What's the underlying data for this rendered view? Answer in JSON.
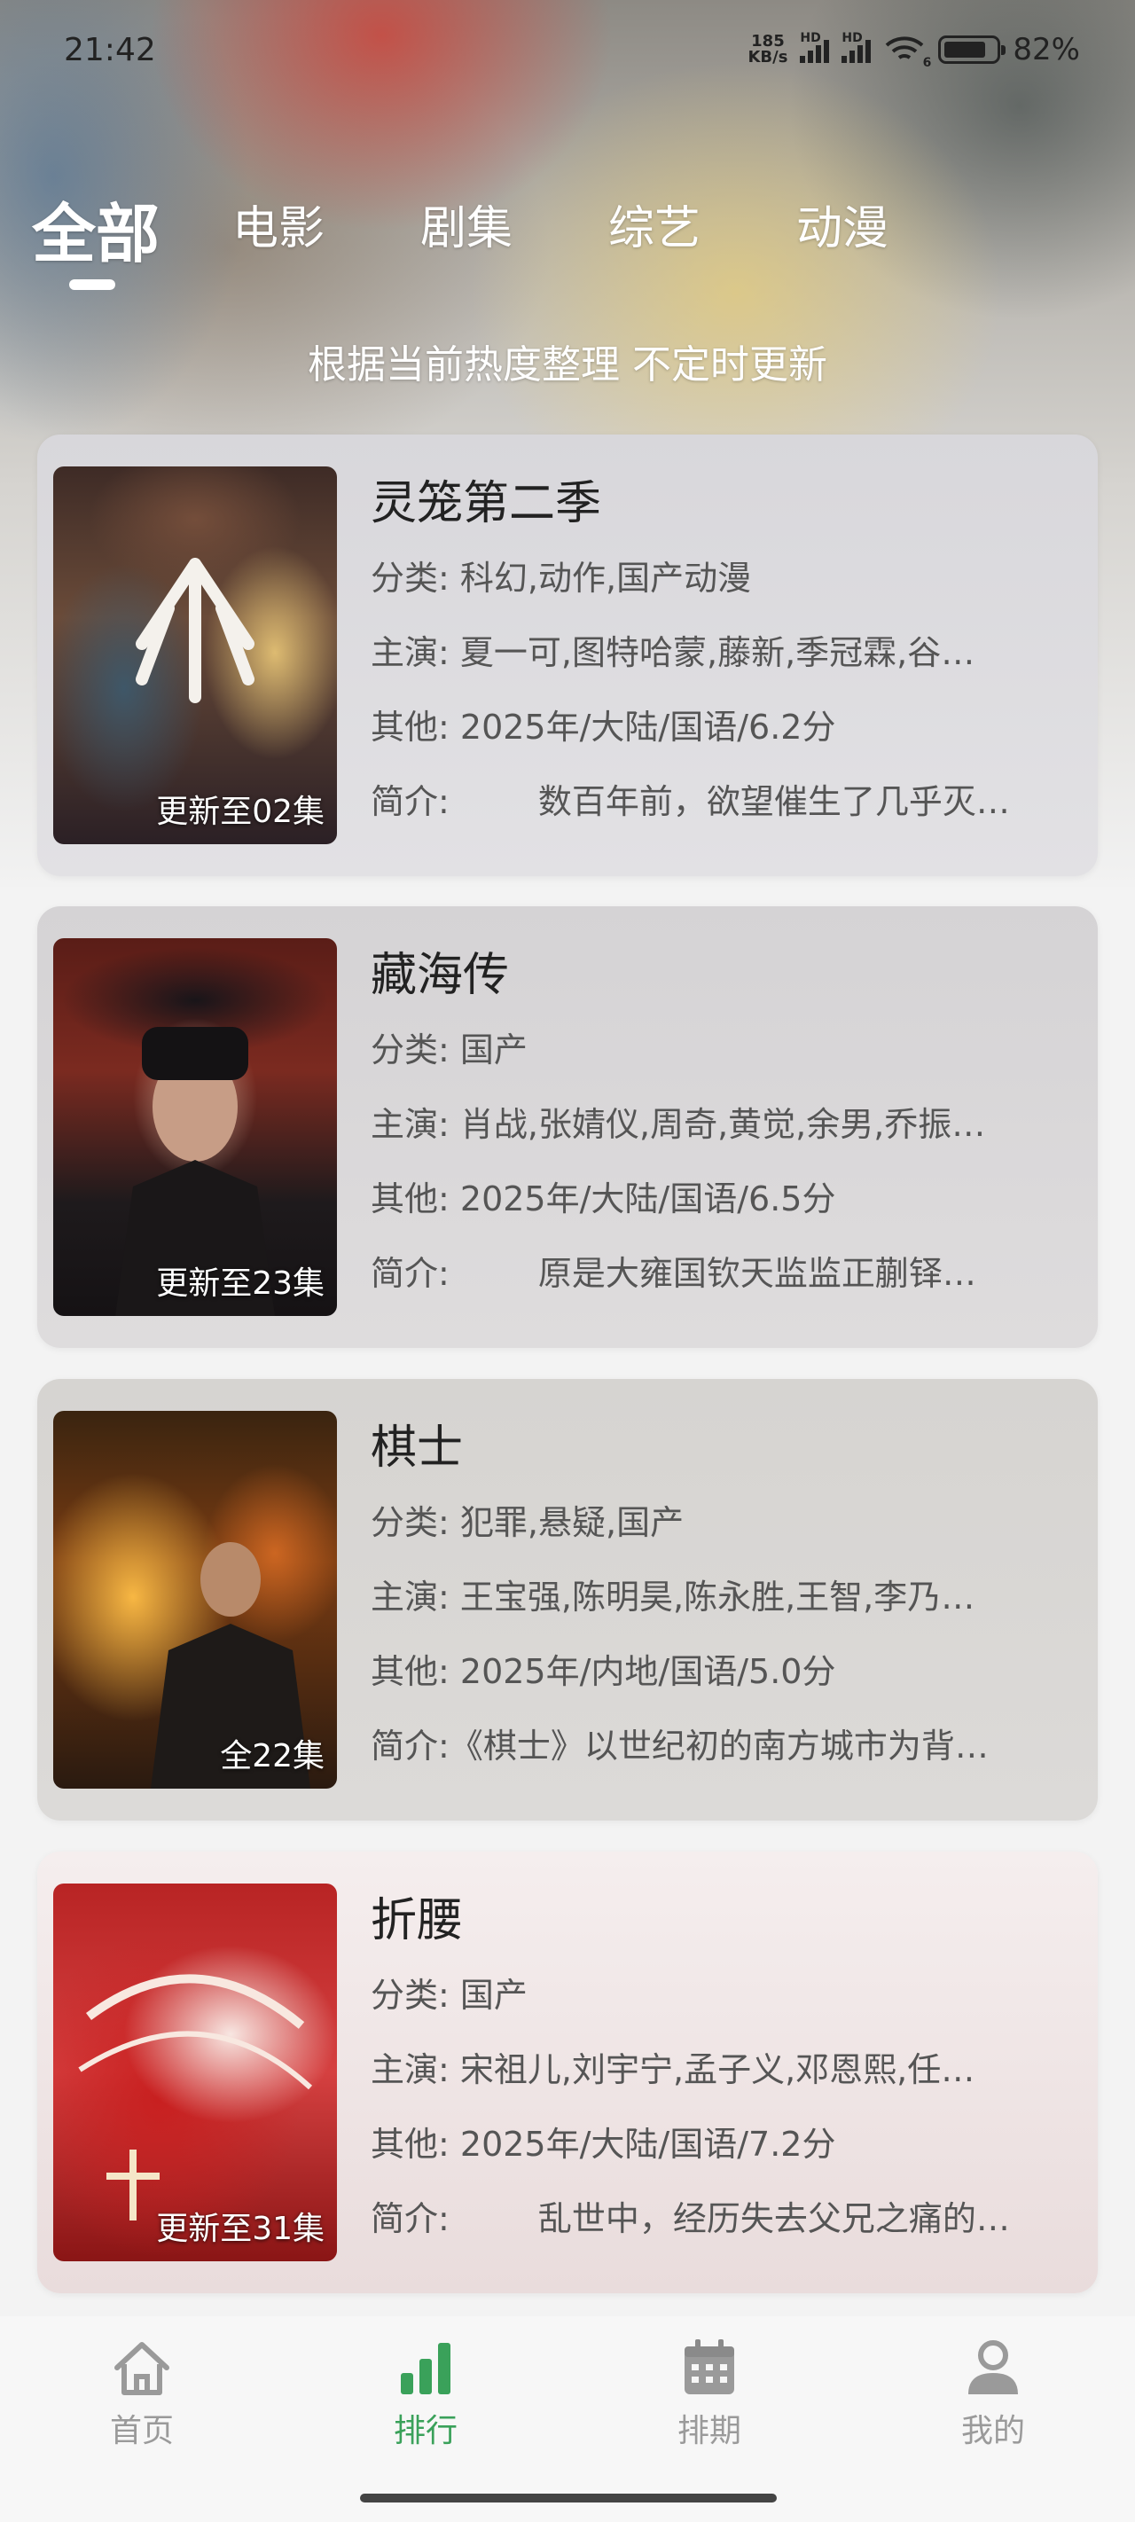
{
  "status_bar": {
    "time": "21:42",
    "net_speed_value": "185",
    "net_speed_unit": "KB/s",
    "sim1_tag": "HD",
    "sim2_tag": "HD",
    "wifi_tag": "6",
    "battery_percent": "82%",
    "battery_level": 0.82
  },
  "tabs": [
    {
      "label": "全部",
      "active": true
    },
    {
      "label": "电影",
      "active": false
    },
    {
      "label": "剧集",
      "active": false
    },
    {
      "label": "综艺",
      "active": false
    },
    {
      "label": "动漫",
      "active": false
    }
  ],
  "subtitle": "根据当前热度整理 不定时更新",
  "labels": {
    "category": "分类:",
    "cast": "主演:",
    "other": "其他:",
    "intro": "简介:"
  },
  "items": [
    {
      "title": "灵笼第二季",
      "episode": "更新至02集",
      "category": "科幻,动作,国产动漫",
      "cast": "夏一可,图特哈蒙,藤新,季冠霖,谷…",
      "other": "2025年/大陆/国语/6.2分",
      "intro": "数百年前，欲望催生了几乎灭…",
      "intro_indented": true
    },
    {
      "title": "藏海传",
      "episode": "更新至23集",
      "category": "国产",
      "cast": "肖战,张婧仪,周奇,黄觉,余男,乔振…",
      "other": "2025年/大陆/国语/6.5分",
      "intro": "原是大雍国钦天监监正蒯铎…",
      "intro_indented": true
    },
    {
      "title": "棋士",
      "episode": "全22集",
      "category": "犯罪,悬疑,国产",
      "cast": "王宝强,陈明昊,陈永胜,王智,李乃…",
      "other": "2025年/内地/国语/5.0分",
      "intro": "《棋士》以世纪初的南方城市为背…",
      "intro_indented": false
    },
    {
      "title": "折腰",
      "episode": "更新至31集",
      "category": "国产",
      "cast": "宋祖儿,刘宇宁,孟子义,邓恩熙,任…",
      "other": "2025年/大陆/国语/7.2分",
      "intro": "乱世中，经历失去父兄之痛的…",
      "intro_indented": true
    }
  ],
  "nav": [
    {
      "label": "首页",
      "icon": "home-icon",
      "active": false
    },
    {
      "label": "排行",
      "icon": "ranking-icon",
      "active": true
    },
    {
      "label": "排期",
      "icon": "calendar-icon",
      "active": false
    },
    {
      "label": "我的",
      "icon": "profile-icon",
      "active": false
    }
  ],
  "colors": {
    "accent": "#3aa15a",
    "nav_inactive": "#9a9a9a"
  }
}
